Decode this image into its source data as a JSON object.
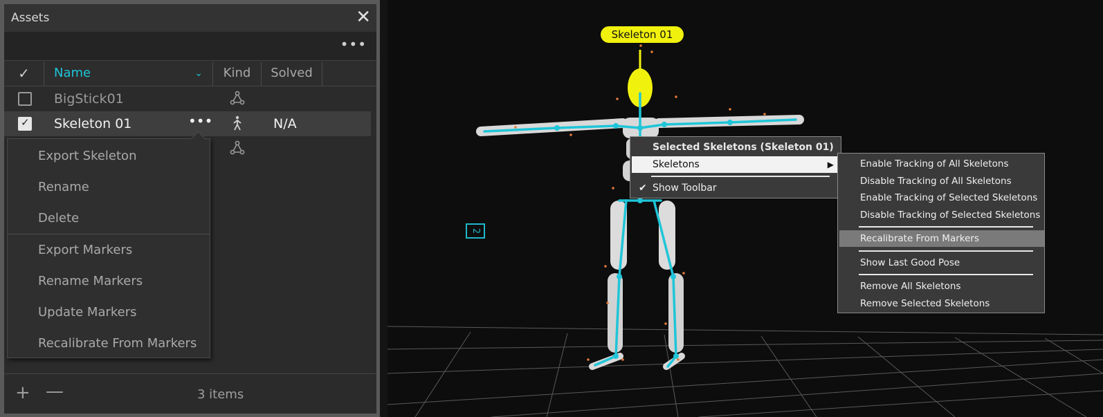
{
  "assets": {
    "title": "Assets",
    "close": "✕",
    "toolbar_more": "•••",
    "columns": {
      "check": "✓",
      "name": "Name",
      "name_chevron": "⌄",
      "kind": "Kind",
      "solved": "Solved"
    },
    "rows": [
      {
        "name": "BigStick01",
        "checked": false,
        "kind_icon": "rigid-body-icon",
        "solved": ""
      },
      {
        "name": "Skeleton 01",
        "checked": true,
        "kind_icon": "skeleton-icon",
        "solved": "N/A",
        "more": "•••"
      },
      {
        "name": "",
        "checked": false,
        "kind_icon": "rigid-body-icon",
        "solved": ""
      }
    ],
    "menu": [
      "Export Skeleton",
      "Rename",
      "Delete",
      "Export Markers",
      "Rename Markers",
      "Update Markers",
      "Recalibrate From Markers"
    ],
    "footer": {
      "add": "+",
      "remove": "—",
      "count": "3 items"
    }
  },
  "viewport": {
    "skeleton_label": "Skeleton 01",
    "camera_badge": "2",
    "context_menu": {
      "header": "Selected Skeletons (Skeleton 01)",
      "skeletons": "Skeletons",
      "submenu_arrow": "▶",
      "show_toolbar": "Show Toolbar",
      "check": "✔"
    },
    "submenu": [
      "Enable Tracking of All Skeletons",
      "Disable Tracking of All Skeletons",
      "Enable Tracking of Selected Skeletons",
      "Disable Tracking of Selected Skeletons",
      "Recalibrate From Markers",
      "Show Last Good Pose",
      "Remove All Skeletons",
      "Remove Selected Skeletons"
    ],
    "highlighted_item": "Recalibrate From Markers"
  },
  "colors": {
    "accent_cyan": "#1fc5d8",
    "label_yellow": "#f1f10e",
    "panel_bg": "#2b2b2b",
    "viewport_bg": "#0d0d0d"
  }
}
